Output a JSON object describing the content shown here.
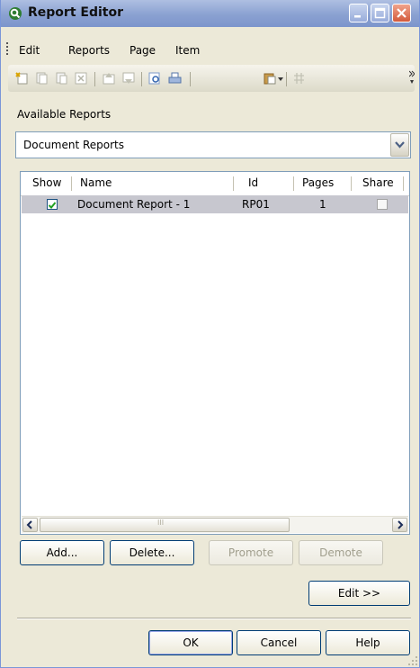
{
  "window": {
    "title": "Report Editor"
  },
  "menu": [
    "Edit",
    "Reports",
    "Page",
    "Item"
  ],
  "toolbar": {
    "icons": [
      "new-report-icon",
      "copy-report-icon",
      "paste-report-icon",
      "delete-report-icon",
      "move-up-icon",
      "move-down-icon",
      "print-preview-icon",
      "print-icon",
      "paste-dropdown-icon",
      "layout-icon"
    ]
  },
  "available_reports": {
    "label": "Available Reports",
    "selected": "Document Reports"
  },
  "report_list": {
    "columns": [
      "Show",
      "Name",
      "Id",
      "Pages",
      "Share"
    ],
    "rows": [
      {
        "show": true,
        "name": "Document Report - 1",
        "id": "RP01",
        "pages": "1",
        "share": false
      }
    ],
    "scroll_glyph": "III"
  },
  "buttons": {
    "add": "Add...",
    "delete": "Delete...",
    "promote": "Promote",
    "demote": "Demote",
    "edit": "Edit >>",
    "ok": "OK",
    "cancel": "Cancel",
    "help": "Help"
  }
}
